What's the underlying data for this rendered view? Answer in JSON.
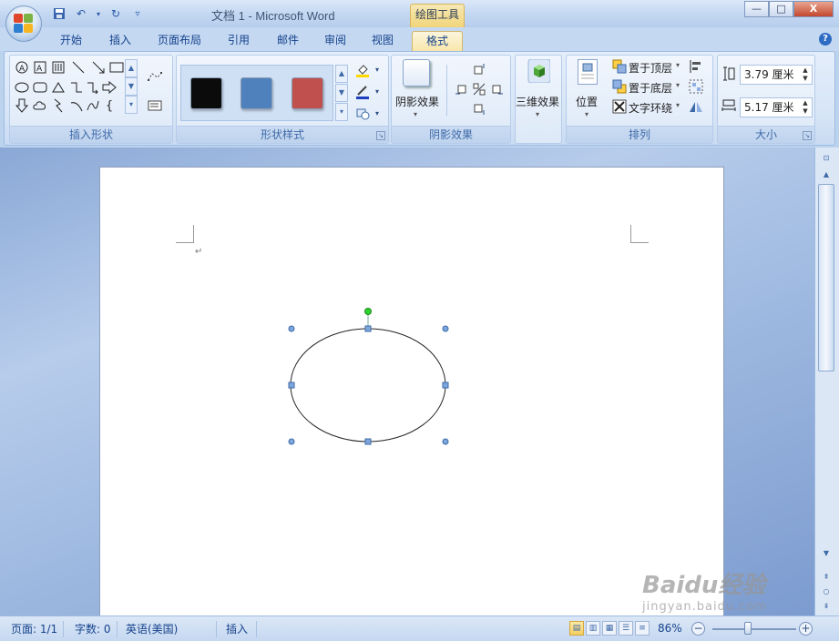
{
  "window": {
    "title": "文档 1 - Microsoft Word",
    "contextual_tool": "绘图工具",
    "controls": {
      "minimize": "—",
      "maximize": "□",
      "close": "X"
    }
  },
  "qat": {
    "save": "save-icon",
    "undo": "undo-icon",
    "redo": "redo-icon",
    "customize": "▿"
  },
  "tabs": [
    {
      "label": "开始"
    },
    {
      "label": "插入"
    },
    {
      "label": "页面布局"
    },
    {
      "label": "引用"
    },
    {
      "label": "邮件"
    },
    {
      "label": "审阅"
    },
    {
      "label": "视图"
    },
    {
      "label": "格式",
      "active": true
    }
  ],
  "ribbon": {
    "groups": {
      "insert_shapes": "插入形状",
      "shape_styles": "形状样式",
      "shadow_effects": "阴影效果",
      "arrange": "排列",
      "size": "大小"
    },
    "style_swatches": [
      {
        "color": "#0b0b0b"
      },
      {
        "color": "#4f81bd"
      },
      {
        "color": "#c0504d"
      }
    ],
    "shadow_button": "阴影效果",
    "threed_button": "三维效果",
    "position_button": "位置",
    "bring_to_front": "置于顶层",
    "send_to_back": "置于底层",
    "text_wrap": "文字环绕",
    "height": "3.79 厘米",
    "width": "5.17 厘米"
  },
  "status": {
    "page": "页面: 1/1",
    "words": "字数: 0",
    "language": "英语(美国)",
    "mode": "插入",
    "zoom": "86%",
    "zoom_percent": 86
  },
  "watermark": {
    "brand": "Baidu经验",
    "sub": "jingyan.baidu.com"
  }
}
